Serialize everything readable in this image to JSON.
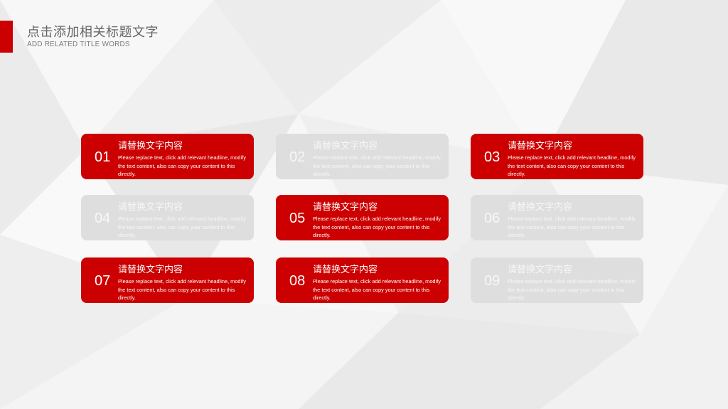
{
  "header": {
    "title": "点击添加相关标题文字",
    "subtitle": "ADD RELATED TITLE WORDS"
  },
  "colors": {
    "accent": "#cc0000",
    "card_inactive": "#dedede",
    "background": "#f2f2f2"
  },
  "cards": [
    {
      "number": "01",
      "heading": "请替换文字内容",
      "text": "Please replace text, click add relevant headline, modify the text content, also can copy your content to this directly.",
      "style": "red"
    },
    {
      "number": "02",
      "heading": "请替换文字内容",
      "text": "Please replace text, click add relevant headline, modify the text content, also can copy your content to this directly.",
      "style": "grey"
    },
    {
      "number": "03",
      "heading": "请替换文字内容",
      "text": "Please replace text, click add relevant headline, modify the text content, also can copy your content to this directly.",
      "style": "red"
    },
    {
      "number": "04",
      "heading": "请替换文字内容",
      "text": "Please replace text, click add relevant headline, modify the text content, also can copy your content to this directly.",
      "style": "grey"
    },
    {
      "number": "05",
      "heading": "请替换文字内容",
      "text": "Please replace text, click add relevant headline, modify the text content, also can copy your content to this directly.",
      "style": "red"
    },
    {
      "number": "06",
      "heading": "请替换文字内容",
      "text": "Please replace text, click add relevant headline, modify the text content, also can copy your content to this directly.",
      "style": "grey"
    },
    {
      "number": "07",
      "heading": "请替换文字内容",
      "text": "Please replace text, click add relevant headline, modify the text content, also can copy your content to this directly.",
      "style": "red"
    },
    {
      "number": "08",
      "heading": "请替换文字内容",
      "text": "Please replace text, click add relevant headline, modify the text content, also can copy your content to this directly.",
      "style": "red"
    },
    {
      "number": "09",
      "heading": "请替换文字内容",
      "text": "Please replace text, click add relevant headline, modify the text content, also can copy your content to this directly.",
      "style": "grey"
    }
  ]
}
